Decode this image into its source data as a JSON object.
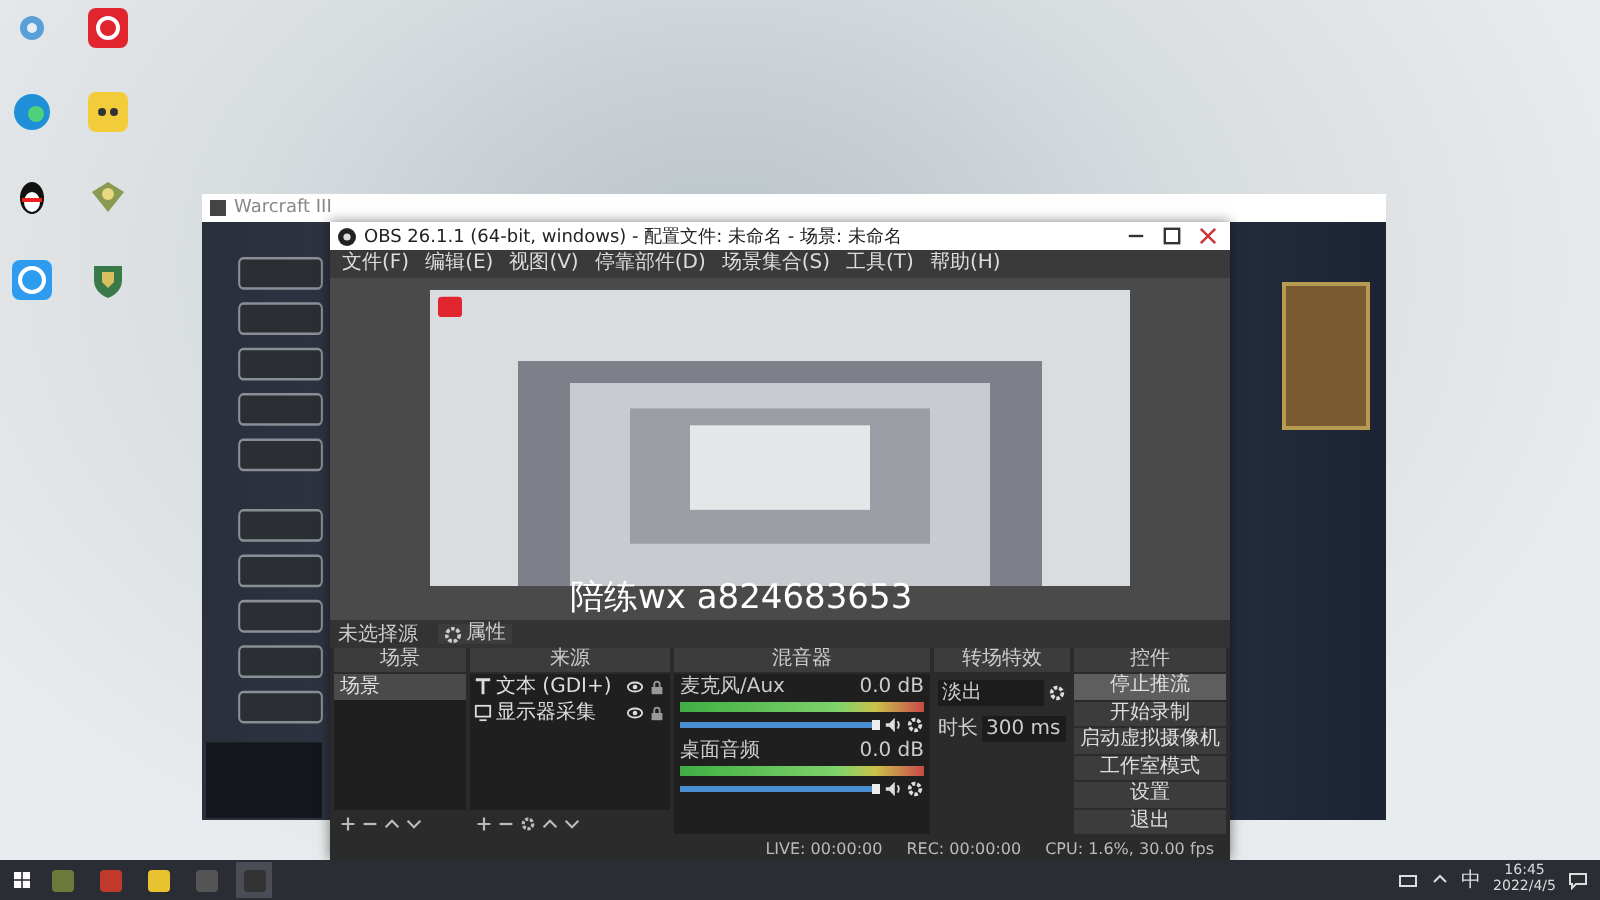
{
  "warcraft_window": {
    "title": "Warcraft III"
  },
  "obs": {
    "title": "OBS 26.1.1 (64-bit, windows) - 配置文件: 未命名 - 场景: 未命名",
    "menu": [
      "文件(F)",
      "编辑(E)",
      "视图(V)",
      "停靠部件(D)",
      "场景集合(S)",
      "工具(T)",
      "帮助(H)"
    ],
    "overlay_text": "陪练wx a824683653",
    "source_bar": {
      "label": "未选择源",
      "button": "属性"
    },
    "scenes": {
      "title": "场景",
      "items": [
        {
          "label": "场景",
          "selected": true
        }
      ]
    },
    "sources": {
      "title": "来源",
      "items": [
        {
          "label": "文本 (GDI+)",
          "kind": "text",
          "visible": true
        },
        {
          "label": "显示器采集",
          "kind": "display",
          "visible": true
        }
      ]
    },
    "mixer": {
      "title": "混音器",
      "channels": [
        {
          "name": "麦克风/Aux",
          "reading": "0.0 dB",
          "level": 1.0
        },
        {
          "name": "桌面音频",
          "reading": "0.0 dB",
          "level": 1.0
        }
      ]
    },
    "transitions": {
      "title": "转场特效",
      "selected": "淡出",
      "duration_label": "时长",
      "duration": "300 ms"
    },
    "controls": {
      "title": "控件",
      "buttons": [
        {
          "label": "停止推流",
          "active": true
        },
        {
          "label": "开始录制",
          "active": false
        },
        {
          "label": "启动虚拟摄像机",
          "active": false
        },
        {
          "label": "工作室模式",
          "active": false
        },
        {
          "label": "设置",
          "active": false
        },
        {
          "label": "退出",
          "active": false
        }
      ]
    },
    "status": {
      "live": "LIVE: 00:00:00",
      "rec": "REC: 00:00:00",
      "cpu": "CPU: 1.6%, 30.00 fps"
    }
  },
  "taskbar": {
    "apps": [
      {
        "kind": "game",
        "selected": false
      },
      {
        "kind": "fire",
        "selected": false
      },
      {
        "kind": "face",
        "selected": false
      },
      {
        "kind": "box",
        "selected": false
      },
      {
        "kind": "obs",
        "selected": true
      }
    ],
    "input_method": "中",
    "time": "16:45",
    "date": "2022/4/5"
  }
}
